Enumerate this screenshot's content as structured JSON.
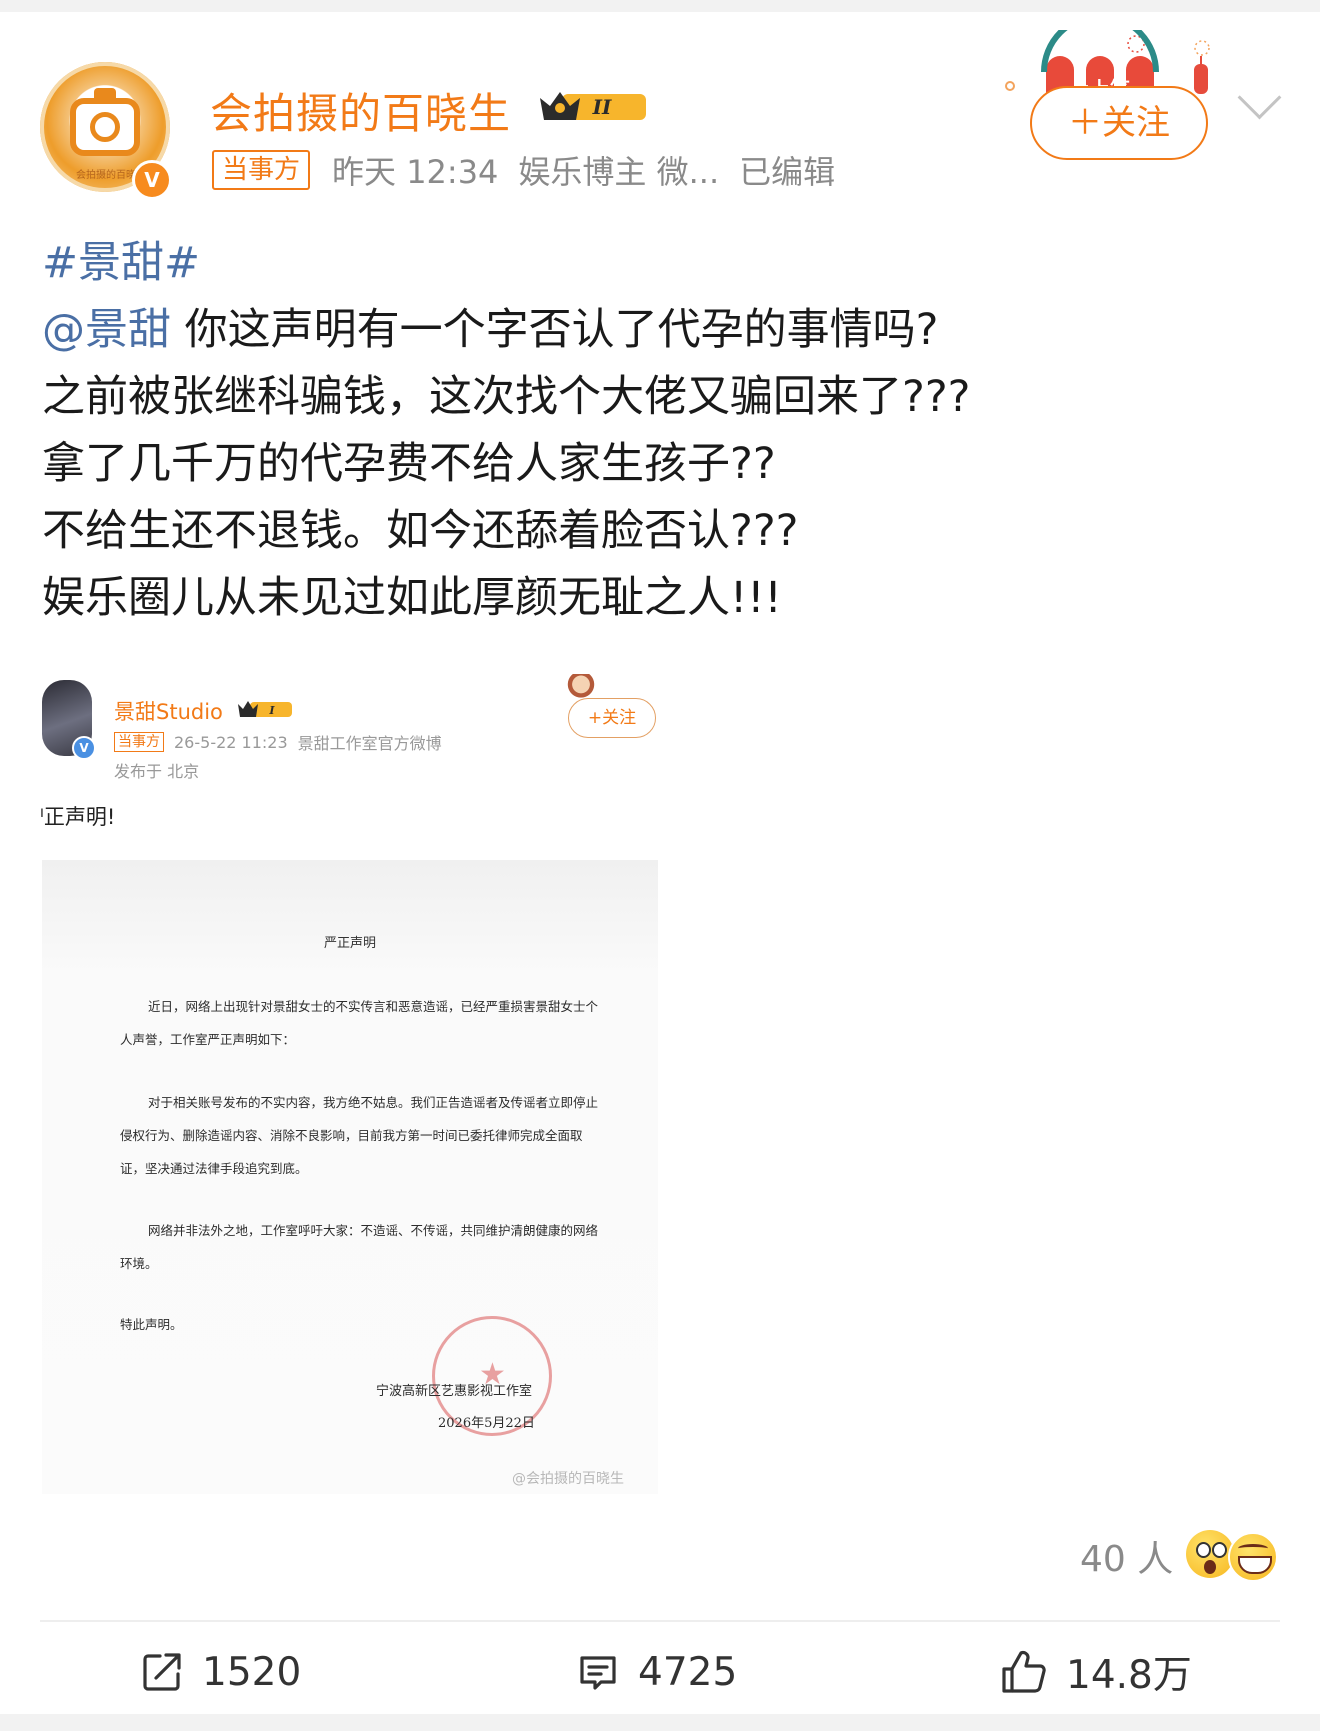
{
  "author": {
    "name": "会拍摄的百晓生",
    "avatar_caption": "会拍摄的百晓",
    "verified_mark": "V",
    "level_badge": "II",
    "party_tag": "当事方",
    "time": "昨天 12:34",
    "category": "娱乐博主 微...",
    "edited": "已编辑"
  },
  "header": {
    "festival_badge_text": "上上签",
    "follow_label": "＋关注"
  },
  "post": {
    "hashtag": "#景甜#",
    "mention": "@景甜",
    "lines": [
      " 你这声明有一个字否认了代孕的事情吗?",
      "之前被张继科骗钱，这次找个大佬又骗回来了???",
      "拿了几千万的代孕费不给人家生孩子??",
      "不给生还不退钱。如今还舔着脸否认???",
      "娱乐圈儿从未见过如此厚颜无耻之人!!!"
    ]
  },
  "embedded": {
    "name": "景甜Studio",
    "level_badge": "I",
    "party_tag": "当事方",
    "time": "26-5-22 11:23",
    "source": "景甜工作室官方微博",
    "location": "发布于 北京",
    "follow_label": "+关注",
    "text": "ᴵ正声明!",
    "document": {
      "title": "严正声明",
      "p1": "近日，网络上出现针对景甜女士的不实传言和恶意造谣，已经严重损害景甜女士个人声誉，工作室严正声明如下：",
      "p2": "对于相关账号发布的不实内容，我方绝不姑息。我们正告造谣者及传谣者立即停止侵权行为、删除造谣内容、消除不良影响，目前我方第一时间已委托律师完成全面取证，坚决通过法律手段追究到底。",
      "p3": "网络并非法外之地，工作室呼吁大家：不造谣、不传谣，共同维护清朗健康的网络环境。",
      "closing": "特此声明。",
      "org": "宁波高新区艺惠影视工作室",
      "date": "2026年5月22日",
      "watermark": "@会拍摄的百晓生"
    }
  },
  "reactions": {
    "count": "40 人"
  },
  "actions": {
    "repost": "1520",
    "comment": "4725",
    "like": "14.8万"
  },
  "colors": {
    "brand_orange": "#f27a17",
    "link_blue": "#4a6fa5"
  }
}
